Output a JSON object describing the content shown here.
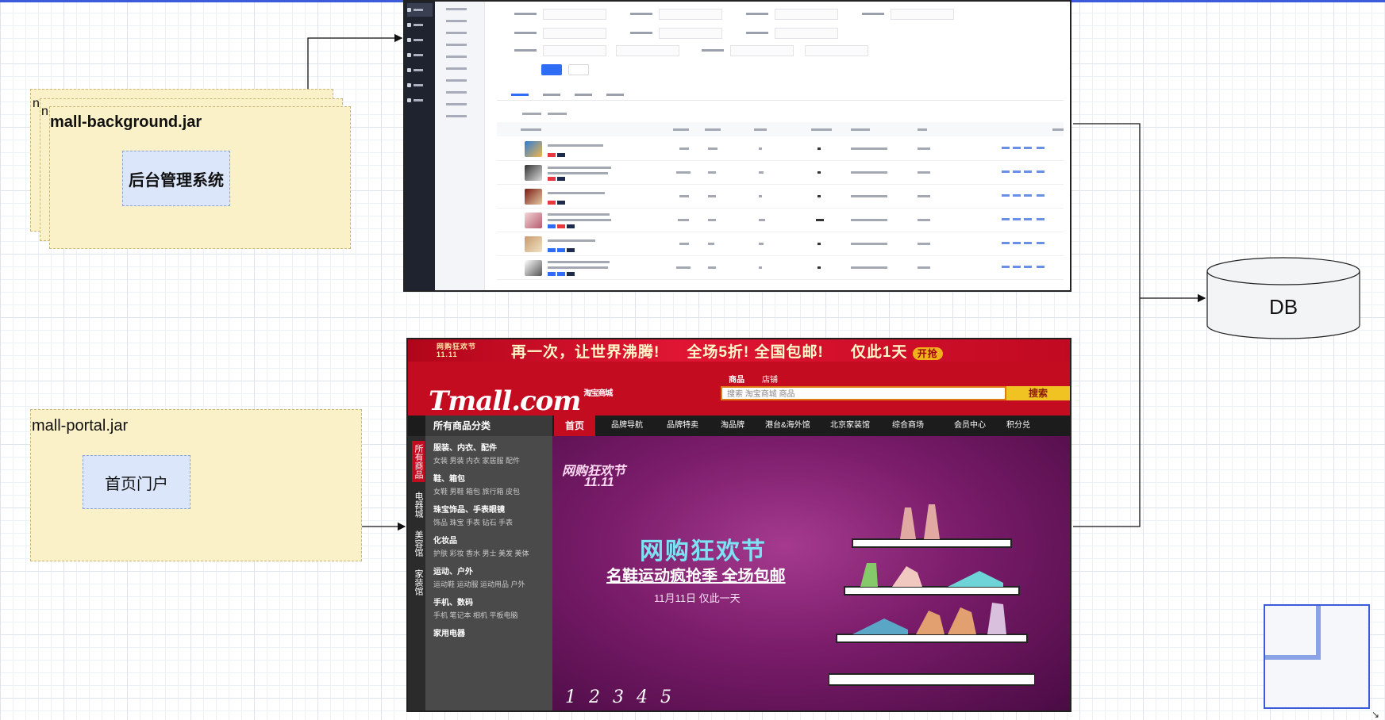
{
  "diagram": {
    "background_jar": {
      "title": "mall-background.jar",
      "service": "后台管理系统",
      "stack_marker_1": "n",
      "stack_marker_2": "n"
    },
    "portal_jar": {
      "title": "mall-portal.jar",
      "service": "首页门户"
    },
    "database": {
      "label": "DB"
    }
  },
  "tmall": {
    "banner": {
      "event": "网购狂欢节 11.11",
      "slogan1": "再一次，让世界沸腾!",
      "slogan2": "全场5折! 全国包邮!",
      "slogan3": "仅此1天",
      "cta": "开抢"
    },
    "logo": "Tmall.com",
    "logo_sub": "淘宝商城",
    "search_tabs": [
      "商品",
      "店铺"
    ],
    "search_placeholder": "搜索 淘宝商城 商品",
    "search_button": "搜索",
    "category_header": "所有商品分类",
    "nav": [
      "首页",
      "品牌导航",
      "品牌特卖",
      "淘品牌",
      "港台&海外馆",
      "北京家装馆",
      "综合商场",
      "会员中心",
      "积分兑"
    ],
    "side_tabs": [
      "所有商品",
      "电器城",
      "美容馆",
      "家装馆"
    ],
    "categories": [
      {
        "title": "服装、内衣、配件",
        "sub": "女装 男装 内衣 家居服 配件"
      },
      {
        "title": "鞋、箱包",
        "sub": "女鞋 男鞋 箱包 旅行箱 皮包"
      },
      {
        "title": "珠宝饰品、手表眼镜",
        "sub": "饰品 珠宝 手表 钻石 手表"
      },
      {
        "title": "化妆品",
        "sub": "护肤 彩妆 香水 男士 美发 美体"
      },
      {
        "title": "运动、户外",
        "sub": "运动鞋 运动服 运动用品 户外"
      },
      {
        "title": "手机、数码",
        "sub": "手机 笔记本 相机 平板电脑"
      },
      {
        "title": "家用电器",
        "sub": ""
      }
    ],
    "hero": {
      "festival": "网购狂欢节",
      "date": "11.11",
      "headline": "网购狂欢节",
      "subline": "名鞋运动疯抢季 全场包邮",
      "note": "11月11日 仅此一天"
    },
    "pages": [
      "1",
      "2",
      "3",
      "4",
      "5"
    ]
  },
  "colors": {
    "jar_fill": "#fbf1c8",
    "service_fill": "#dbe6fb",
    "tmall_red": "#c40c20",
    "admin_dark": "#1f2330",
    "accent": "#3b5bdb"
  }
}
